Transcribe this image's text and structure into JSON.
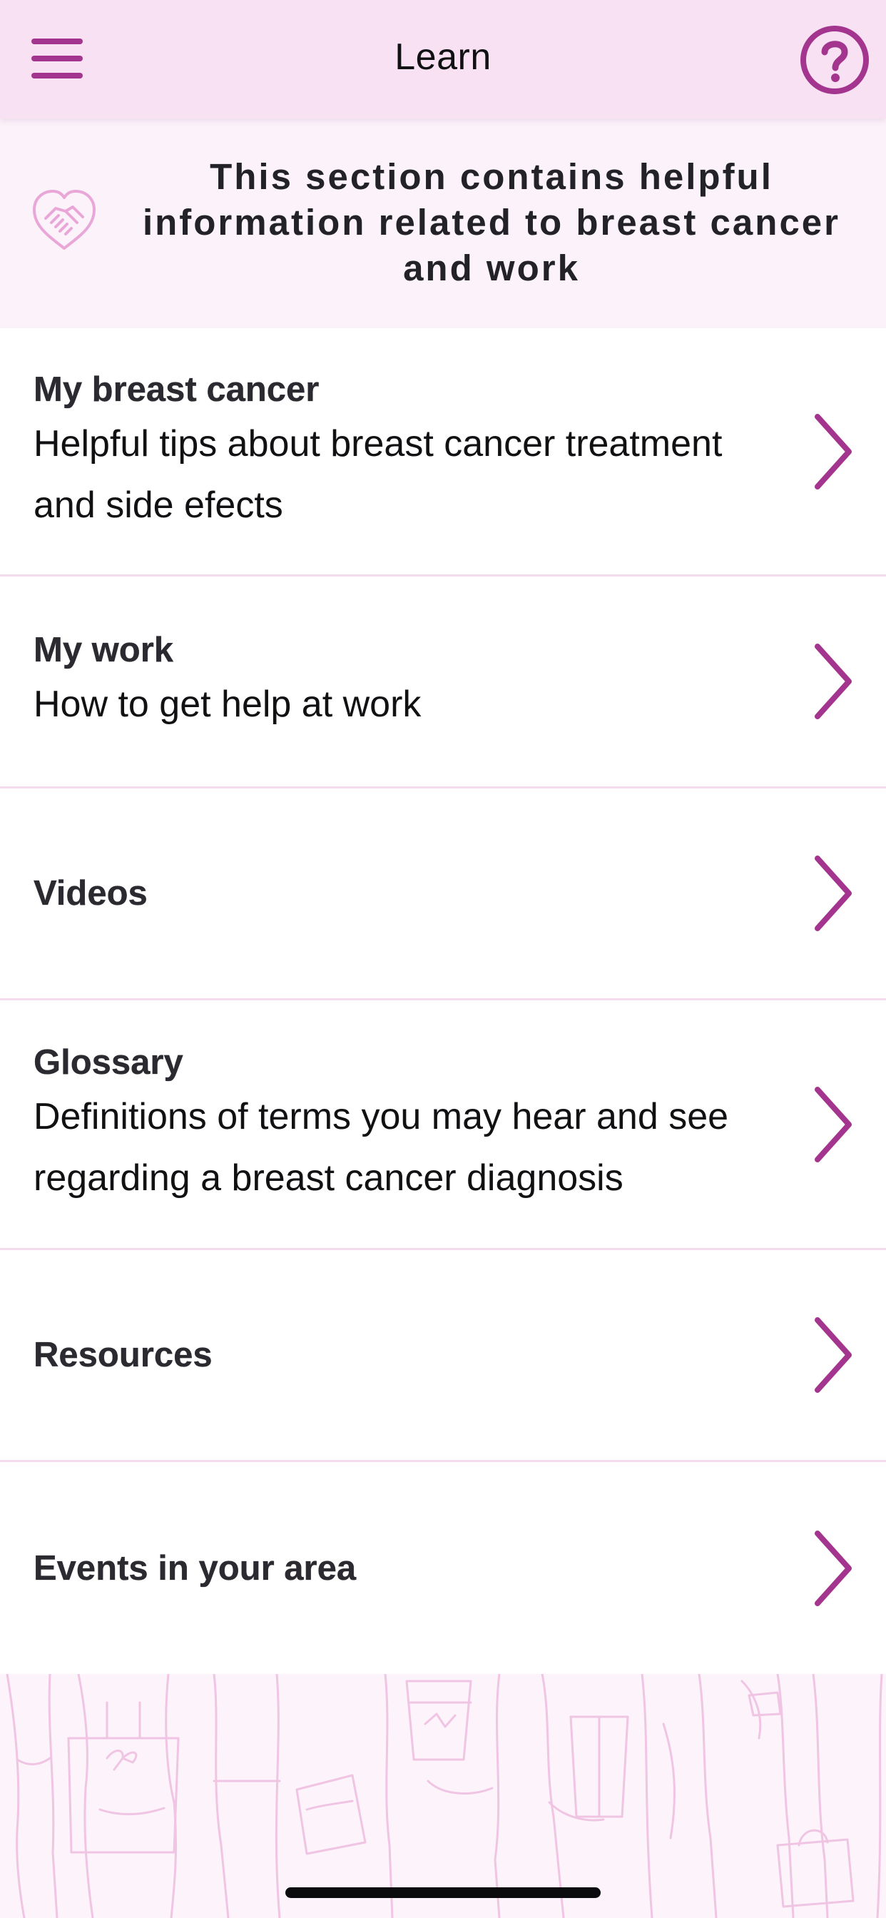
{
  "colors": {
    "accent": "#a3358e",
    "navbar_bg": "#f7e1f2",
    "banner_bg": "#fcf2fa",
    "divider": "#f4dcee"
  },
  "navbar": {
    "title": "Learn",
    "menu_icon": "hamburger-menu-icon",
    "help_icon": "question-circle-icon"
  },
  "banner": {
    "icon": "heart-handshake-icon",
    "text": "This section contains helpful information related to breast cancer and work"
  },
  "items": [
    {
      "title": "My breast cancer",
      "subtitle": "Helpful tips about breast cancer treatment and side efects",
      "icon": "chevron-right-icon"
    },
    {
      "title": "My work",
      "subtitle": "How to get help at work",
      "icon": "chevron-right-icon"
    },
    {
      "title": "Videos",
      "subtitle": "",
      "icon": "chevron-right-icon"
    },
    {
      "title": "Glossary",
      "subtitle": "Definitions of terms you may hear and see regarding a breast cancer diagnosis",
      "icon": "chevron-right-icon"
    },
    {
      "title": "Resources",
      "subtitle": "",
      "icon": "chevron-right-icon"
    },
    {
      "title": "Events in your area",
      "subtitle": "",
      "icon": "chevron-right-icon"
    }
  ]
}
